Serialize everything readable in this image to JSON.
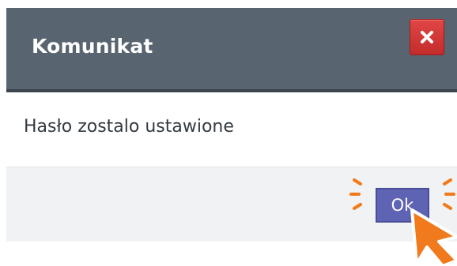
{
  "dialog": {
    "title": "Komunikat",
    "message": "Hasło zostalo ustawione",
    "ok_label": "Ok"
  },
  "icons": {
    "close": "close-icon",
    "cursor": "cursor-arrow-icon",
    "highlight": "click-highlight-icon"
  },
  "colors": {
    "titlebar": "#58646f",
    "close_button": "#d63b3b",
    "ok_button": "#5f63b3",
    "highlight": "#f07a1c"
  }
}
